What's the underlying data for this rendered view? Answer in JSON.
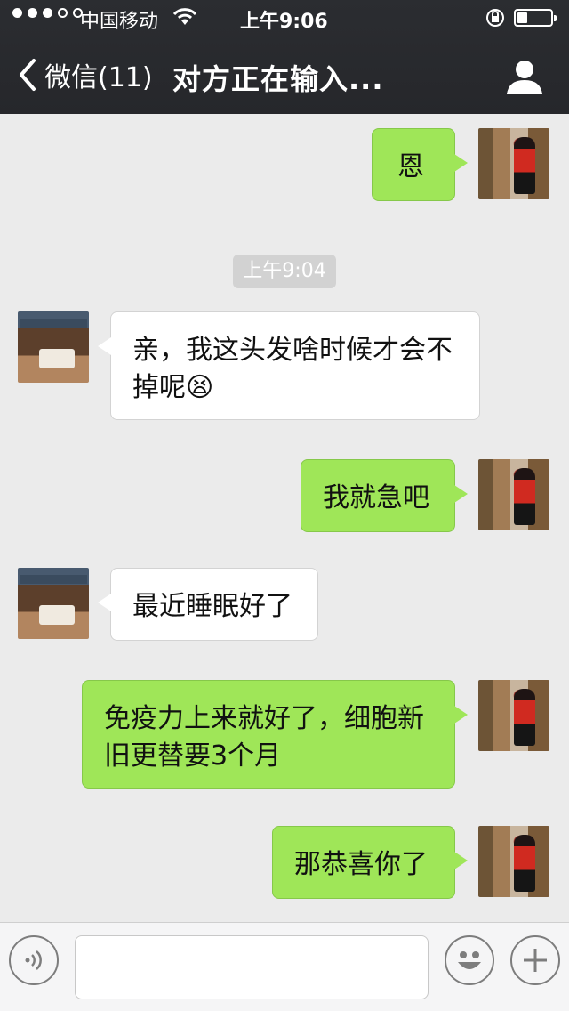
{
  "status_bar": {
    "carrier": "中国移动",
    "time": "上午9:06"
  },
  "nav": {
    "back_label": "微信(11)",
    "title": "对方正在输入..."
  },
  "timestamp": "上午9:04",
  "messages": [
    {
      "side": "right",
      "text": "恩"
    },
    {
      "side": "left",
      "text": "亲，我这头发啥时候才会不掉呢😫"
    },
    {
      "side": "right",
      "text": "我就急吧"
    },
    {
      "side": "left",
      "text": "最近睡眠好了"
    },
    {
      "side": "right",
      "text": "免疫力上来就好了，细胞新旧更替要3个月"
    },
    {
      "side": "right",
      "text": "那恭喜你了"
    }
  ],
  "input": {
    "value": "",
    "placeholder": ""
  },
  "icons": {
    "status": [
      "signal-icon",
      "wifi-icon",
      "rotation-lock-icon",
      "battery-icon"
    ],
    "nav": [
      "back-chevron-icon",
      "profile-icon"
    ],
    "input": [
      "voice-icon",
      "emoji-icon",
      "plus-icon"
    ]
  },
  "colors": {
    "top_bar": "#26272b",
    "chat_background": "#ebebeb",
    "sent_bubble": "#9fe658",
    "received_bubble": "#ffffff",
    "timestamp_pill": "#d2d2d2"
  }
}
